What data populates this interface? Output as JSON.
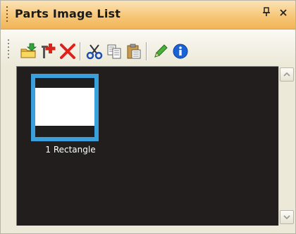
{
  "panel": {
    "title": "Parts Image List",
    "pin_glyph": "Ȱ",
    "close_glyph": "×"
  },
  "toolbar": {
    "buttons": [
      {
        "name": "import-image-icon"
      },
      {
        "name": "add-part-icon"
      },
      {
        "name": "delete-icon"
      },
      {
        "name": "cut-icon"
      },
      {
        "name": "copy-icon"
      },
      {
        "name": "paste-icon"
      },
      {
        "name": "edit-pencil-icon"
      },
      {
        "name": "info-icon"
      }
    ]
  },
  "list": {
    "items": [
      {
        "label": "1 Rectangle",
        "selected": true
      }
    ]
  },
  "colors": {
    "titlebar": "#f6c778",
    "viewport": "#221e1e",
    "selection": "#3aa0dc"
  }
}
